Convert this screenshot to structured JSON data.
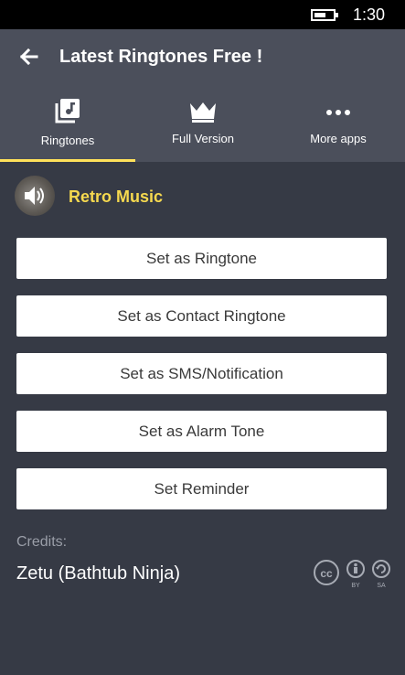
{
  "status_bar": {
    "time": "1:30"
  },
  "app_bar": {
    "title": "Latest Ringtones Free !"
  },
  "tabs": [
    {
      "label": "Ringtones",
      "icon": "music-library-icon",
      "active": true
    },
    {
      "label": "Full Version",
      "icon": "crown-icon",
      "active": false
    },
    {
      "label": "More apps",
      "icon": "more-dots-icon",
      "active": false
    }
  ],
  "track": {
    "name": "Retro Music",
    "icon": "speaker-icon"
  },
  "actions": [
    {
      "label": "Set as Ringtone"
    },
    {
      "label": "Set as Contact Ringtone"
    },
    {
      "label": "Set as SMS/Notification"
    },
    {
      "label": "Set as Alarm Tone"
    },
    {
      "label": "Set Reminder"
    }
  ],
  "credits": {
    "label": "Credits:",
    "name": "Zetu (Bathtub Ninja)",
    "license_badges": [
      "cc",
      "BY",
      "SA"
    ]
  },
  "colors": {
    "background": "#363a45",
    "app_bar": "#4b4f5b",
    "accent": "#ffe15a",
    "track_name": "#f6d94f",
    "button_bg": "#ffffff"
  }
}
